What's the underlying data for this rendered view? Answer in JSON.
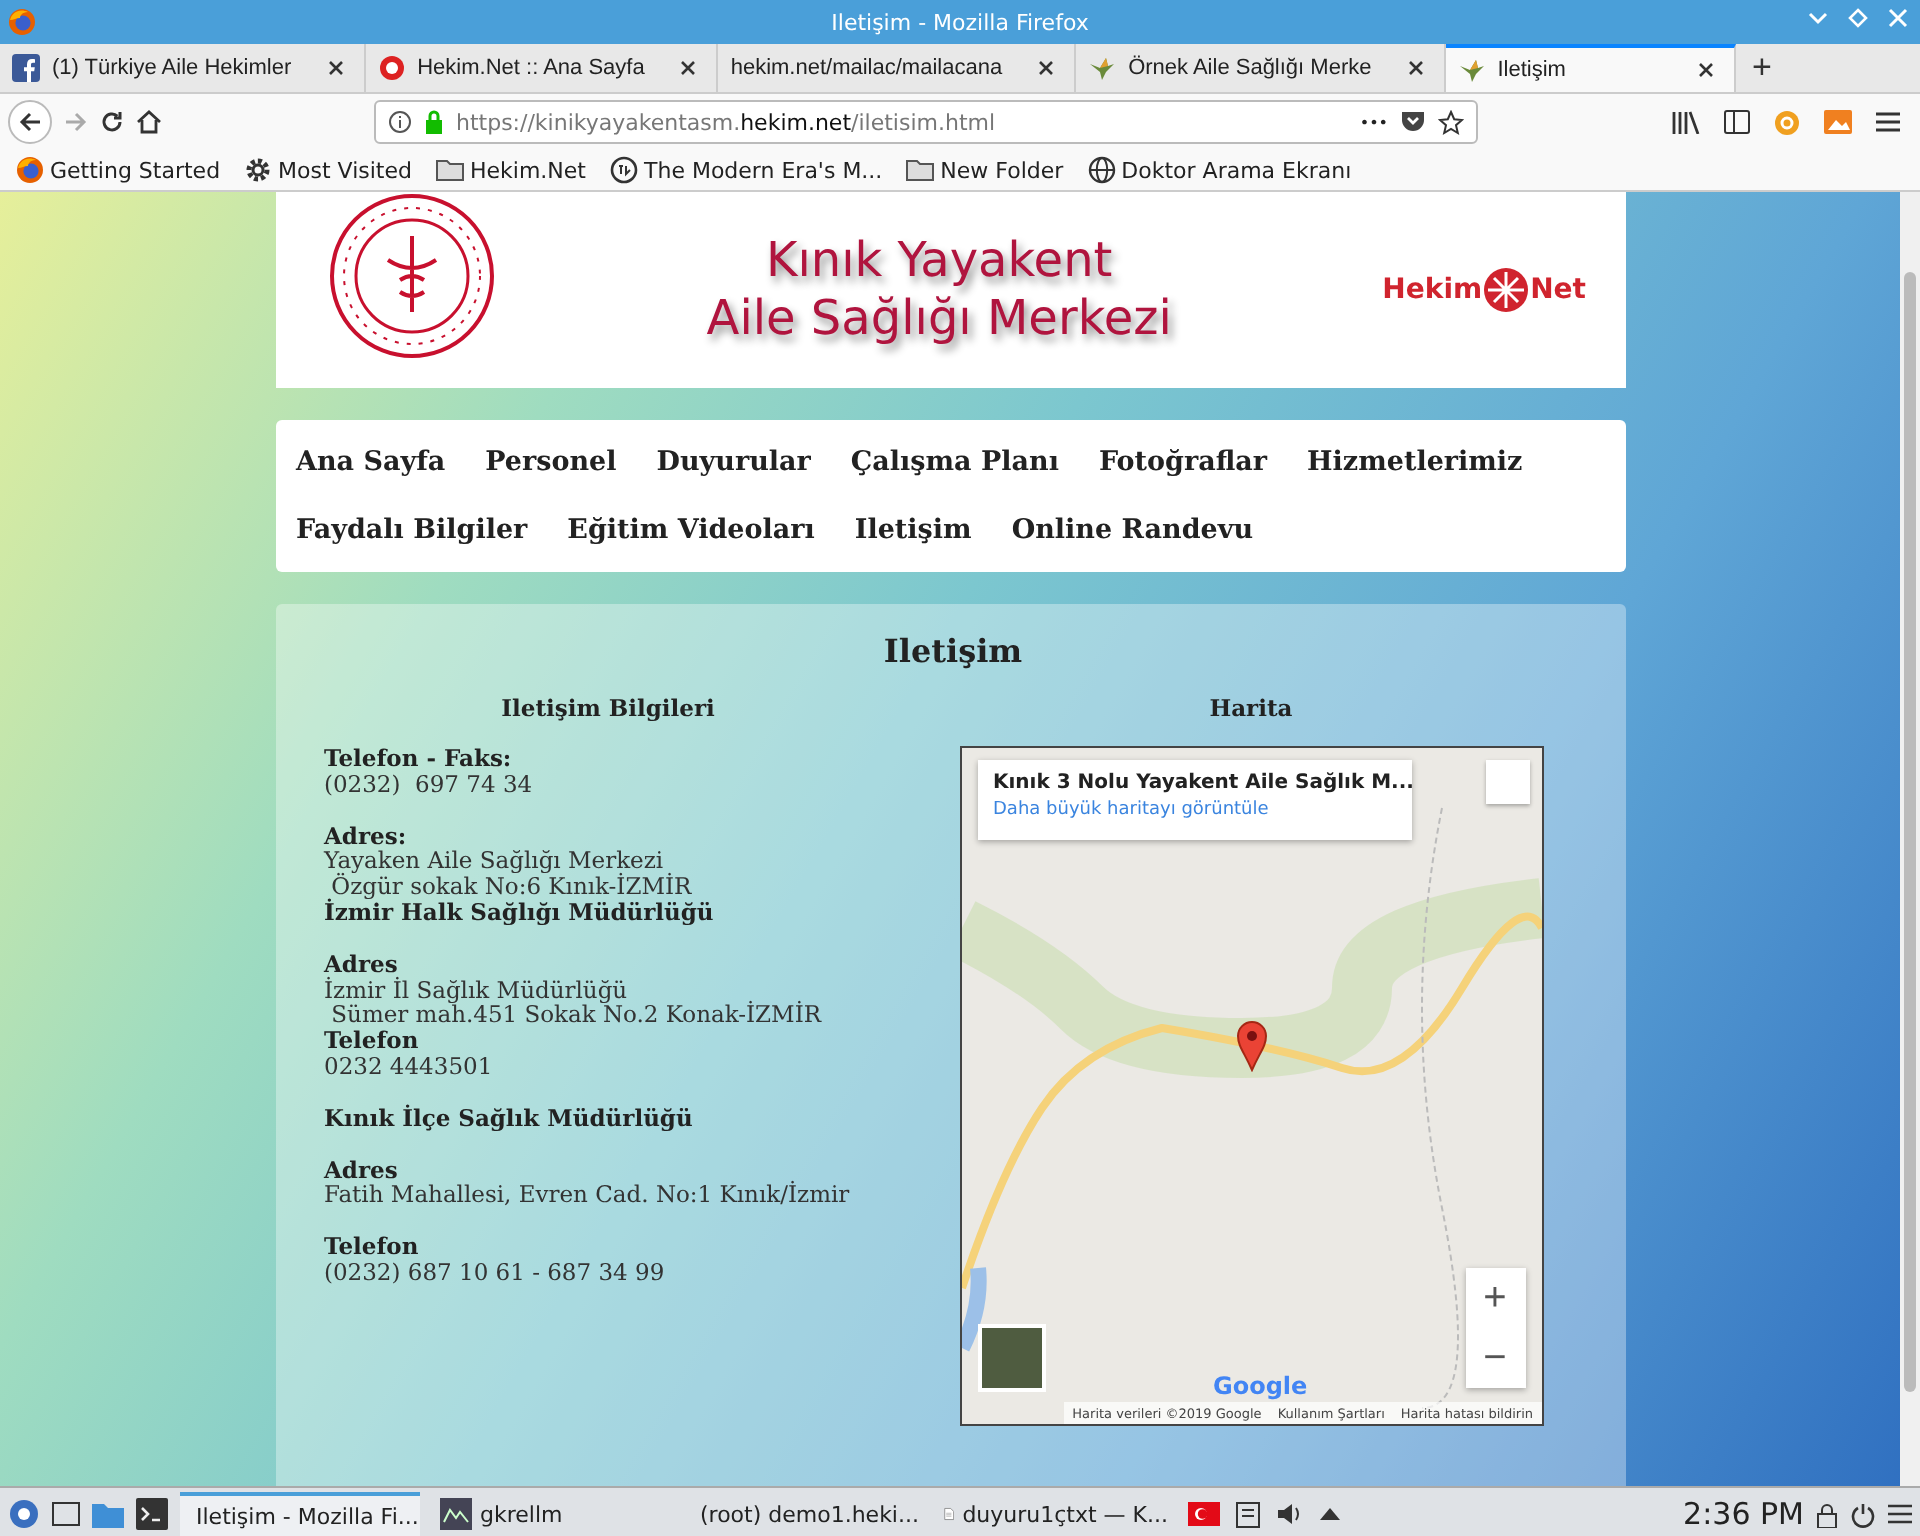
{
  "window": {
    "title": "Iletişim - Mozilla Firefox"
  },
  "tabs": [
    {
      "label": "(1) Türkiye Aile Hekimler",
      "kind": "facebook",
      "selected": false
    },
    {
      "label": "Hekim.Net :: Ana Sayfa",
      "kind": "ring",
      "selected": false
    },
    {
      "label": "hekim.net/mailac/mailacana",
      "kind": "none",
      "selected": false
    },
    {
      "label": "Örnek Aile Sağlığı Merke",
      "kind": "bird",
      "selected": false
    },
    {
      "label": "Iletişim",
      "kind": "bird",
      "selected": true
    }
  ],
  "new_tab": "+",
  "address": {
    "prefix": "https://kinikyayakentasm.",
    "domain": "hekim.net",
    "path": "/iletisim.html"
  },
  "menu_dots": "•••",
  "bookmarks": [
    {
      "label": "Getting Started",
      "kind": "firefox"
    },
    {
      "label": "Most Visited",
      "kind": "gear"
    },
    {
      "label": "Hekim.Net",
      "kind": "folder"
    },
    {
      "label": "The Modern Era's M...",
      "kind": "logo"
    },
    {
      "label": "New Folder",
      "kind": "folder"
    },
    {
      "label": "Doktor Arama Ekranı",
      "kind": "globe"
    }
  ],
  "header": {
    "title_lines": [
      "Kınık Yayakent",
      "Aile Sağlığı Merkezi"
    ],
    "partner": [
      "Hekim",
      "Net"
    ]
  },
  "nav": [
    "Ana Sayfa",
    "Personel",
    "Duyurular",
    "Çalışma Planı",
    "Fotoğraflar",
    "Hizmetlerimiz",
    "Faydalı Bilgiler",
    "Eğitim Videoları",
    "Iletişim",
    "Online Randevu"
  ],
  "contact": {
    "title": "Iletişim",
    "heading": "Iletişim Bilgileri",
    "groups": [
      [
        {
          "text": "Telefon - Faks:",
          "bold": true
        },
        {
          "text": "(0232)  697 74 34",
          "bold": false
        }
      ],
      [
        {
          "text": "Adres:",
          "bold": true
        },
        {
          "text": "Yayaken Aile Sağlığı Merkezi",
          "bold": false
        },
        {
          "text": " Özgür sokak No:6 Kınık-İZMİR",
          "bold": false
        },
        {
          "text": "İzmir Halk Sağlığı Müdürlüğü",
          "bold": true
        }
      ],
      [
        {
          "text": "Adres",
          "bold": true
        },
        {
          "text": "İzmir İl Sağlık Müdürlüğü",
          "bold": false
        },
        {
          "text": " Sümer mah.451 Sokak No.2 Konak-İZMİR",
          "bold": false
        },
        {
          "text": "Telefon",
          "bold": true
        },
        {
          "text": "0232 4443501",
          "bold": false
        }
      ],
      [
        {
          "text": "Kınık İlçe Sağlık Müdürlüğü",
          "bold": true
        }
      ],
      [
        {
          "text": "Adres",
          "bold": true
        },
        {
          "text": "Fatih Mahallesi, Evren Cad. No:1 Kınık/İzmir",
          "bold": false
        }
      ],
      [
        {
          "text": "Telefon",
          "bold": true
        },
        {
          "text": "(0232) 687 10 61 - 687 34 99",
          "bold": false
        }
      ]
    ]
  },
  "map": {
    "heading": "Harita",
    "card_title": "Kınık 3 Nolu Yayakent Aile Sağlık M...",
    "card_link": "Daha büyük haritayı görüntüle",
    "zoom_in": "+",
    "zoom_out": "−",
    "logo": "Google",
    "attribution": [
      "Harita verileri ©2019 Google",
      "Kullanım Şartları",
      "Harita hatası bildirin"
    ]
  },
  "taskbar": {
    "windows": [
      {
        "label": "Iletişim - Mozilla Fi...",
        "kind": "firefox",
        "selected": true
      },
      {
        "label": "gkrellm",
        "kind": "app",
        "selected": false
      },
      {
        "label": "(root) demo1.heki...",
        "kind": "terminal",
        "selected": false
      },
      {
        "label": "duyuru1çtxt — K...",
        "kind": "document",
        "selected": false
      }
    ],
    "clock": "2:36 PM"
  }
}
